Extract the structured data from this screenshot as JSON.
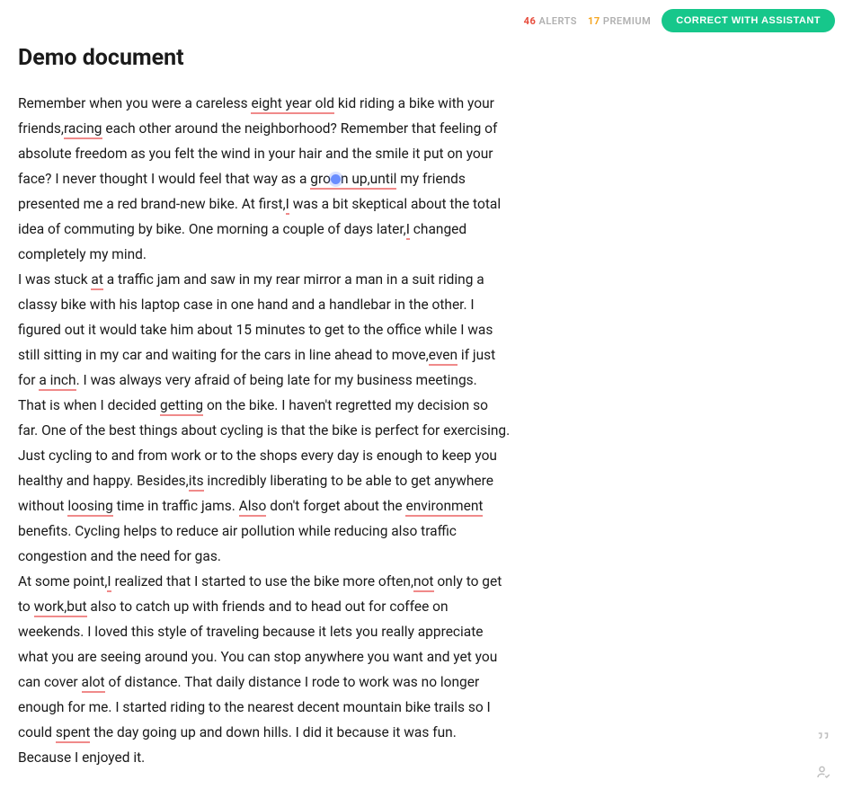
{
  "header": {
    "alerts_count": "46",
    "alerts_label": "ALERTS",
    "premium_count": "17",
    "premium_label": "PREMIUM",
    "assistant_button": "CORRECT WITH ASSISTANT"
  },
  "document": {
    "title": "Demo document",
    "p1": {
      "t0": "Remember when you were a careless ",
      "e0": "eight year old",
      "t1": " kid riding a bike with your friends,",
      "e1": "racing",
      "t2": " each other around the neighborhood? Remember that feeling of absolute freedom as you felt the wind in your hair and the smile it put on your face? I never thought I would feel that way as a ",
      "e2a": "gro",
      "e2b": "n up,until",
      "t3": " my friends presented me a red brand-new bike. At first,",
      "e3": "I",
      "t4": " was a bit skeptical about the total idea of commuting by bike. One morning a couple of days later,",
      "e4": "I",
      "t5": " changed completely my mind."
    },
    "p2": {
      "t0": "I was stuck ",
      "e0": "at",
      "t1": " a traffic jam and saw in my rear mirror a man in a suit riding a classy bike with his laptop case in one hand and a handlebar in the other. I figured out it would take him about 15 minutes to get to the office while I was still sitting in my car and waiting for the cars in line ahead to move,",
      "e1": "even",
      "t2": " if just for ",
      "e2": "a inch",
      "t3": ". I was always very afraid of being late for my business meetings."
    },
    "p3": {
      "t0": "That is when I decided ",
      "e0": "getting",
      "t1": " on the bike. I haven't regretted my decision so far. One of the best things about cycling is that the bike is perfect for exercising. Just cycling to and from work or to the shops every day is enough to keep you healthy and happy. Besides,",
      "e1": "its",
      "t2": " incredibly liberating to be able to get anywhere without ",
      "e2": "loosing",
      "t3": " time in traffic jams. ",
      "e3": "Also",
      "t4": " don't forget about the ",
      "e4": "environment",
      "t5": " benefits. Cycling helps to reduce air pollution while reducing also traffic congestion and the need for gas."
    },
    "p4": {
      "t0": "At some point,",
      "e0": "I",
      "t1": " realized that I started to use the bike more often,",
      "e1": "not",
      "t2": " only to get to ",
      "e2": "work,but",
      "t3": " also to catch up with friends and to head out for coffee on weekends. I loved this style of traveling because it lets you really appreciate what you are seeing around you. You can stop anywhere you want and yet you can cover ",
      "e3": "alot",
      "t4": " of distance. That daily distance I rode to work was no longer enough for me. I started riding to the nearest decent mountain bike trails so I could ",
      "e4": "spent",
      "t5": " the day going up and down hills. I did it because it was fun. Because I enjoyed it."
    }
  }
}
